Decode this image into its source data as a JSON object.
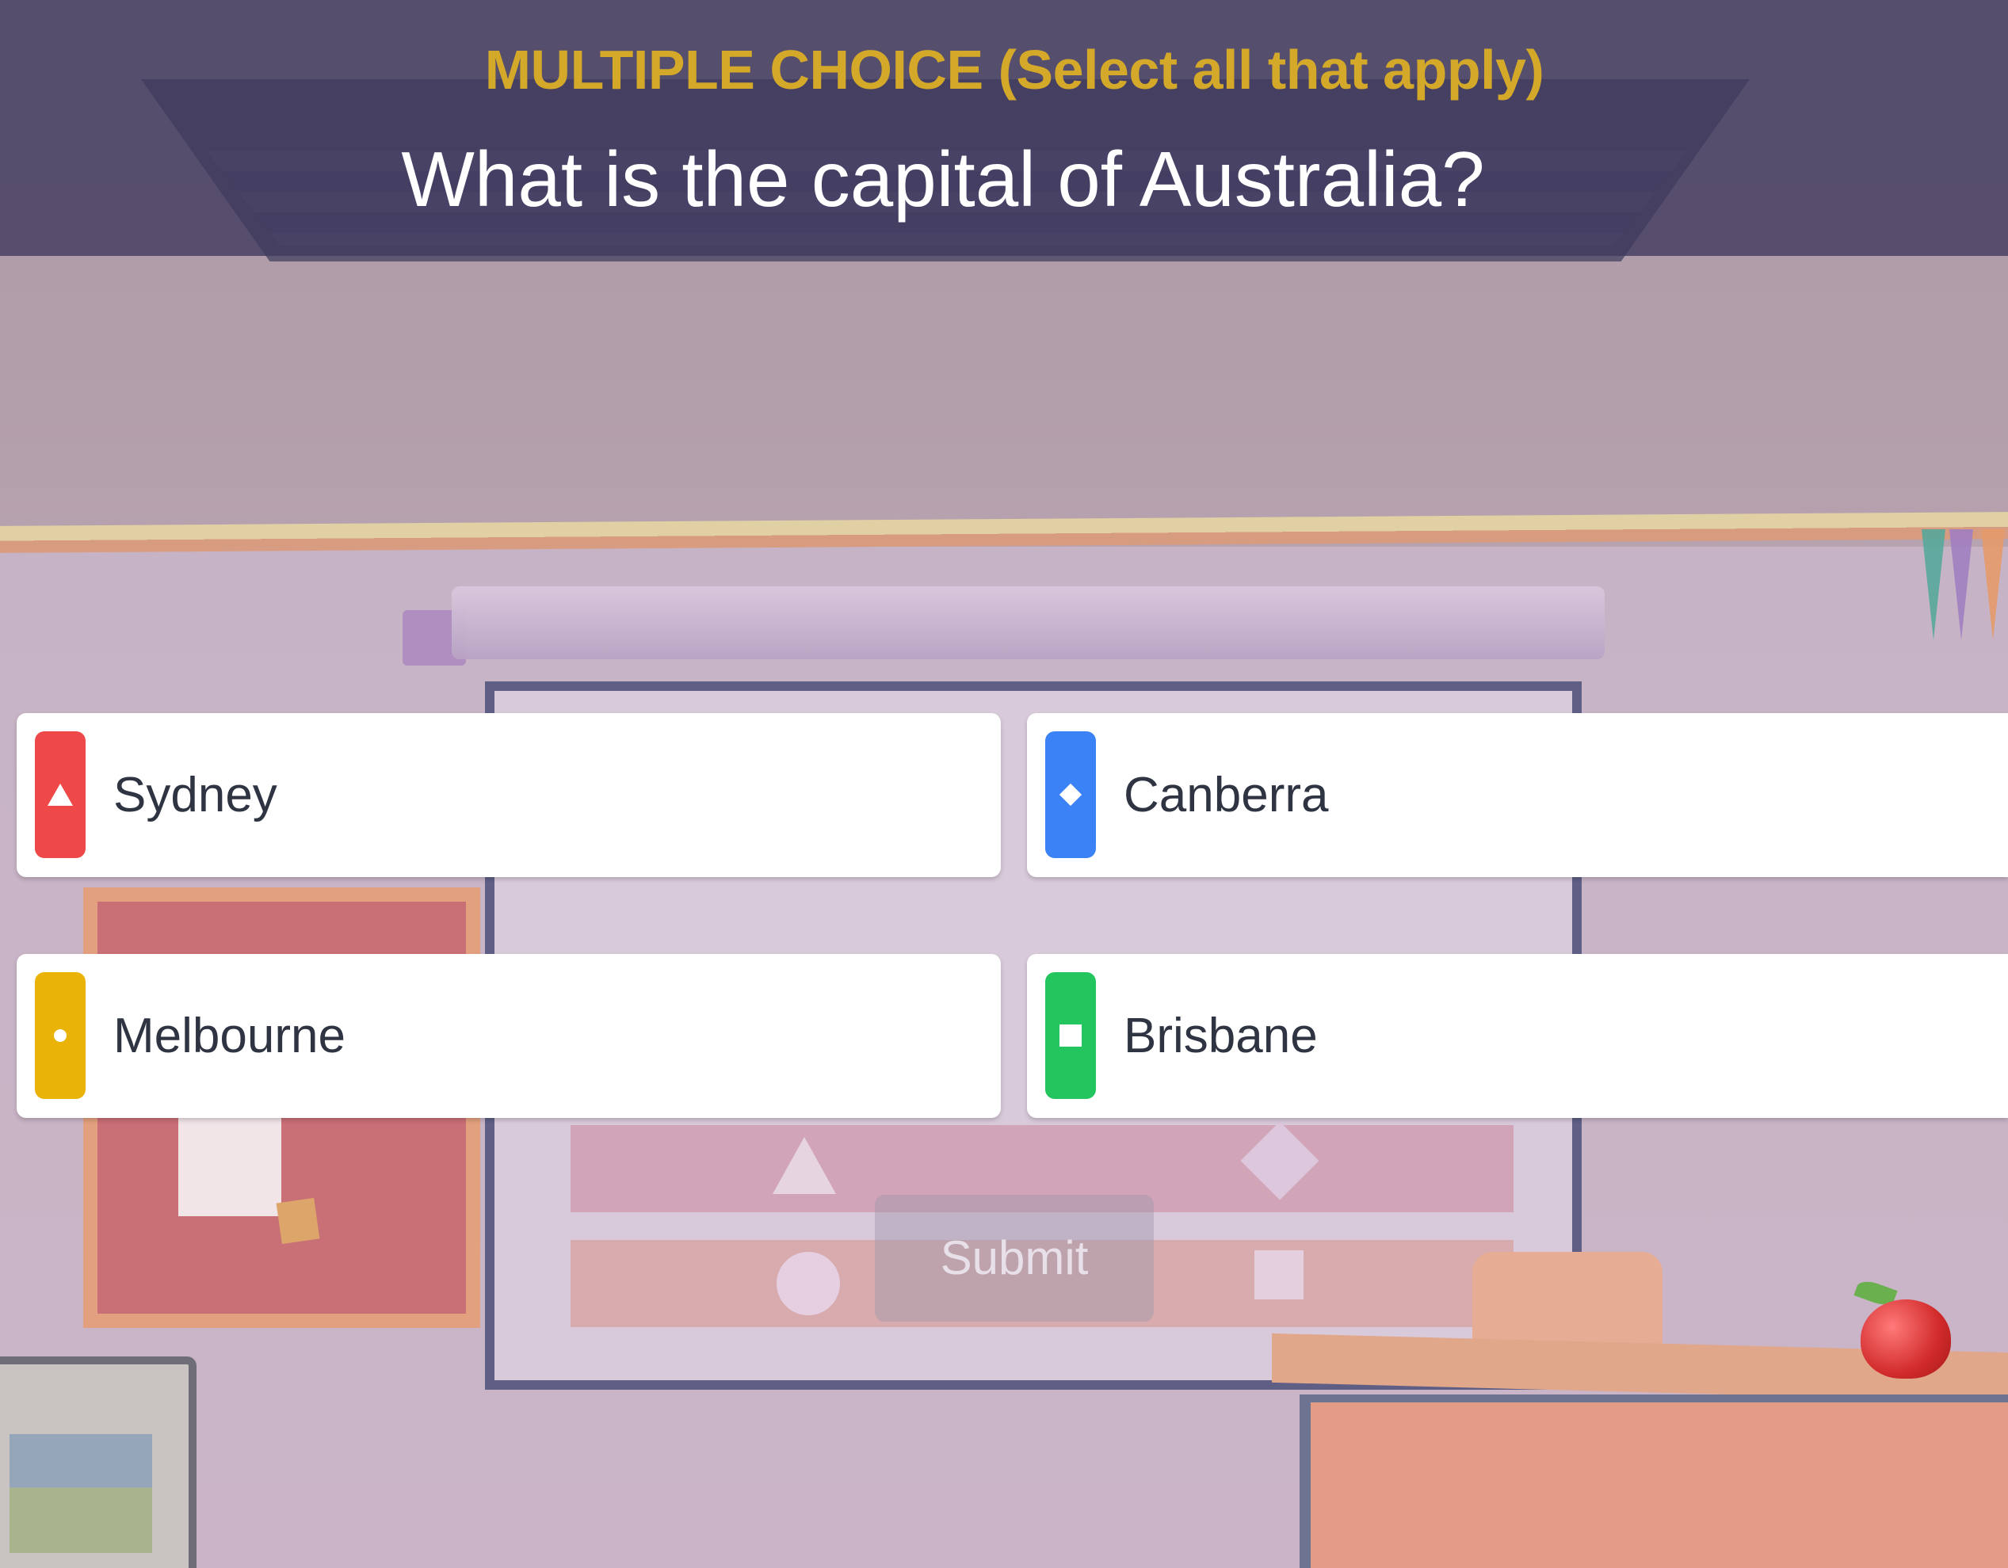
{
  "header": {
    "question_type": "MULTIPLE CHOICE (Select all that apply)",
    "question": "What is the capital of Australia?"
  },
  "answers": [
    {
      "label": "Sydney",
      "color": "#ef4848",
      "icon": "triangle-icon"
    },
    {
      "label": "Canberra",
      "color": "#3b82f6",
      "icon": "diamond-icon"
    },
    {
      "label": "Melbourne",
      "color": "#eab308",
      "icon": "circle-icon"
    },
    {
      "label": "Brisbane",
      "color": "#22c55e",
      "icon": "square-icon"
    }
  ],
  "submit": {
    "label": "Submit",
    "enabled": false
  },
  "colors": {
    "header_bg": "#3e395c",
    "question_type": "#d4a92a",
    "question_text": "#ffffff"
  }
}
